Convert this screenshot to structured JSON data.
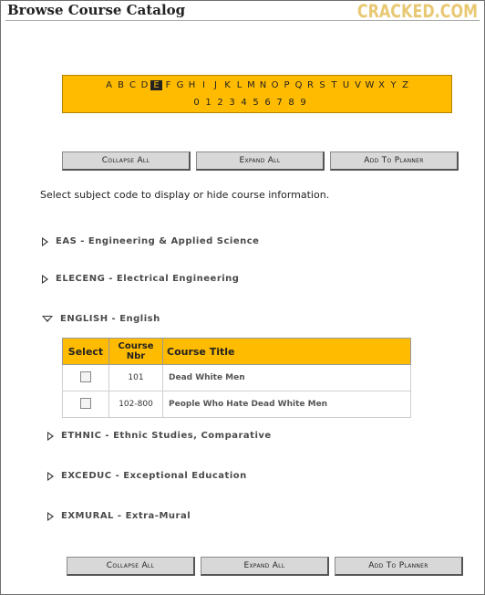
{
  "window": {
    "title": "Browse Course Catalog",
    "brand": "CRACKED.COM"
  },
  "alphabet": {
    "letters": [
      "A",
      "B",
      "C",
      "D",
      "E",
      "F",
      "G",
      "H",
      "I",
      "J",
      "K",
      "L",
      "M",
      "N",
      "O",
      "P",
      "Q",
      "R",
      "S",
      "T",
      "U",
      "V",
      "W",
      "X",
      "Y",
      "Z"
    ],
    "digits": [
      "0",
      "1",
      "2",
      "3",
      "4",
      "5",
      "6",
      "7",
      "8",
      "9"
    ],
    "selected": "E"
  },
  "buttons_top": {
    "collapse": "Collapse All",
    "expand": "Expand All",
    "planner": "Add To Planner"
  },
  "hint": "Select subject code to display or hide course information.",
  "subjects": [
    {
      "code": "EAS",
      "name": "Engineering & Applied Science"
    },
    {
      "code": "ELECENG",
      "name": "Electrical Engineering"
    },
    {
      "code": "ENGLISH",
      "name": "English"
    },
    {
      "code": "ETHNIC",
      "name": "Ethnic Studies, Comparative"
    },
    {
      "code": "EXCEDUC",
      "name": "Exceptional Education"
    },
    {
      "code": "EXMURAL",
      "name": "Extra-Mural"
    }
  ],
  "course_table": {
    "headers": {
      "select": "Select",
      "nbr": "Course Nbr",
      "title": "Course Title"
    },
    "rows": [
      {
        "nbr": "101",
        "title": "Dead White Men"
      },
      {
        "nbr": "102-800",
        "title": "People Who Hate Dead White Men"
      }
    ]
  },
  "buttons_bottom": {
    "collapse": "Collapse All",
    "expand": "Expand All",
    "planner": "Add To Planner"
  },
  "colors": {
    "accent": "#ffbb00",
    "brand": "#e8c873"
  }
}
